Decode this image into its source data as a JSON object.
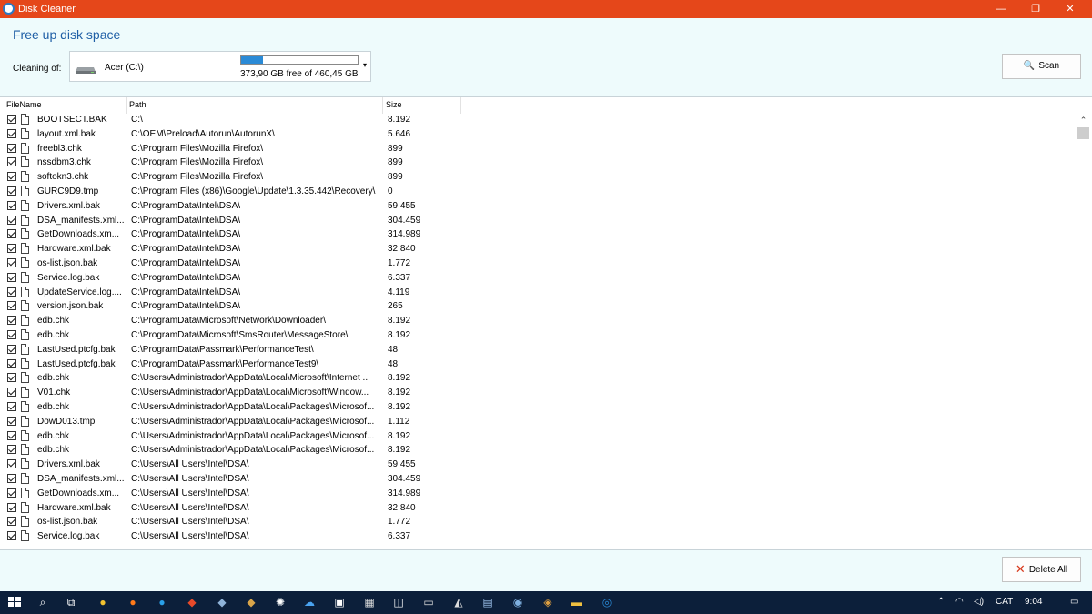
{
  "window": {
    "title": "Disk Cleaner",
    "minimize_glyph": "—",
    "maximize_glyph": "❐",
    "close_glyph": "✕"
  },
  "header": {
    "page_title": "Free up disk space",
    "cleaning_label": "Cleaning of:",
    "drive_name": "Acer (C:\\)",
    "free_text": "373,90 GB free of 460,45 GB",
    "used_fraction": 0.188,
    "scan_label": "Scan"
  },
  "list": {
    "columns": [
      "FileName",
      "Path",
      "Size"
    ],
    "rows": [
      {
        "name": "BOOTSECT.BAK",
        "path": "C:\\",
        "size": "8.192"
      },
      {
        "name": "layout.xml.bak",
        "path": "C:\\OEM\\Preload\\Autorun\\AutorunX\\",
        "size": "5.646"
      },
      {
        "name": "freebl3.chk",
        "path": "C:\\Program Files\\Mozilla Firefox\\",
        "size": "899"
      },
      {
        "name": "nssdbm3.chk",
        "path": "C:\\Program Files\\Mozilla Firefox\\",
        "size": "899"
      },
      {
        "name": "softokn3.chk",
        "path": "C:\\Program Files\\Mozilla Firefox\\",
        "size": "899"
      },
      {
        "name": "GURC9D9.tmp",
        "path": "C:\\Program Files (x86)\\Google\\Update\\1.3.35.442\\Recovery\\",
        "size": "0"
      },
      {
        "name": "Drivers.xml.bak",
        "path": "C:\\ProgramData\\Intel\\DSA\\",
        "size": "59.455"
      },
      {
        "name": "DSA_manifests.xml...",
        "path": "C:\\ProgramData\\Intel\\DSA\\",
        "size": "304.459"
      },
      {
        "name": "GetDownloads.xm...",
        "path": "C:\\ProgramData\\Intel\\DSA\\",
        "size": "314.989"
      },
      {
        "name": "Hardware.xml.bak",
        "path": "C:\\ProgramData\\Intel\\DSA\\",
        "size": "32.840"
      },
      {
        "name": "os-list.json.bak",
        "path": "C:\\ProgramData\\Intel\\DSA\\",
        "size": "1.772"
      },
      {
        "name": "Service.log.bak",
        "path": "C:\\ProgramData\\Intel\\DSA\\",
        "size": "6.337"
      },
      {
        "name": "UpdateService.log....",
        "path": "C:\\ProgramData\\Intel\\DSA\\",
        "size": "4.119"
      },
      {
        "name": "version.json.bak",
        "path": "C:\\ProgramData\\Intel\\DSA\\",
        "size": "265"
      },
      {
        "name": "edb.chk",
        "path": "C:\\ProgramData\\Microsoft\\Network\\Downloader\\",
        "size": "8.192"
      },
      {
        "name": "edb.chk",
        "path": "C:\\ProgramData\\Microsoft\\SmsRouter\\MessageStore\\",
        "size": "8.192"
      },
      {
        "name": "LastUsed.ptcfg.bak",
        "path": "C:\\ProgramData\\Passmark\\PerformanceTest\\",
        "size": "48"
      },
      {
        "name": "LastUsed.ptcfg.bak",
        "path": "C:\\ProgramData\\Passmark\\PerformanceTest9\\",
        "size": "48"
      },
      {
        "name": "edb.chk",
        "path": "C:\\Users\\Administrador\\AppData\\Local\\Microsoft\\Internet ...",
        "size": "8.192"
      },
      {
        "name": "V01.chk",
        "path": "C:\\Users\\Administrador\\AppData\\Local\\Microsoft\\Window...",
        "size": "8.192"
      },
      {
        "name": "edb.chk",
        "path": "C:\\Users\\Administrador\\AppData\\Local\\Packages\\Microsof...",
        "size": "8.192"
      },
      {
        "name": "DowD013.tmp",
        "path": "C:\\Users\\Administrador\\AppData\\Local\\Packages\\Microsof...",
        "size": "1.112"
      },
      {
        "name": "edb.chk",
        "path": "C:\\Users\\Administrador\\AppData\\Local\\Packages\\Microsof...",
        "size": "8.192"
      },
      {
        "name": "edb.chk",
        "path": "C:\\Users\\Administrador\\AppData\\Local\\Packages\\Microsof...",
        "size": "8.192"
      },
      {
        "name": "Drivers.xml.bak",
        "path": "C:\\Users\\All Users\\Intel\\DSA\\",
        "size": "59.455"
      },
      {
        "name": "DSA_manifests.xml...",
        "path": "C:\\Users\\All Users\\Intel\\DSA\\",
        "size": "304.459"
      },
      {
        "name": "GetDownloads.xm...",
        "path": "C:\\Users\\All Users\\Intel\\DSA\\",
        "size": "314.989"
      },
      {
        "name": "Hardware.xml.bak",
        "path": "C:\\Users\\All Users\\Intel\\DSA\\",
        "size": "32.840"
      },
      {
        "name": "os-list.json.bak",
        "path": "C:\\Users\\All Users\\Intel\\DSA\\",
        "size": "1.772"
      },
      {
        "name": "Service.log.bak",
        "path": "C:\\Users\\All Users\\Intel\\DSA\\",
        "size": "6.337"
      }
    ]
  },
  "footer": {
    "delete_label": "Delete All"
  },
  "taskbar": {
    "language": "CAT",
    "time": "9:04"
  }
}
